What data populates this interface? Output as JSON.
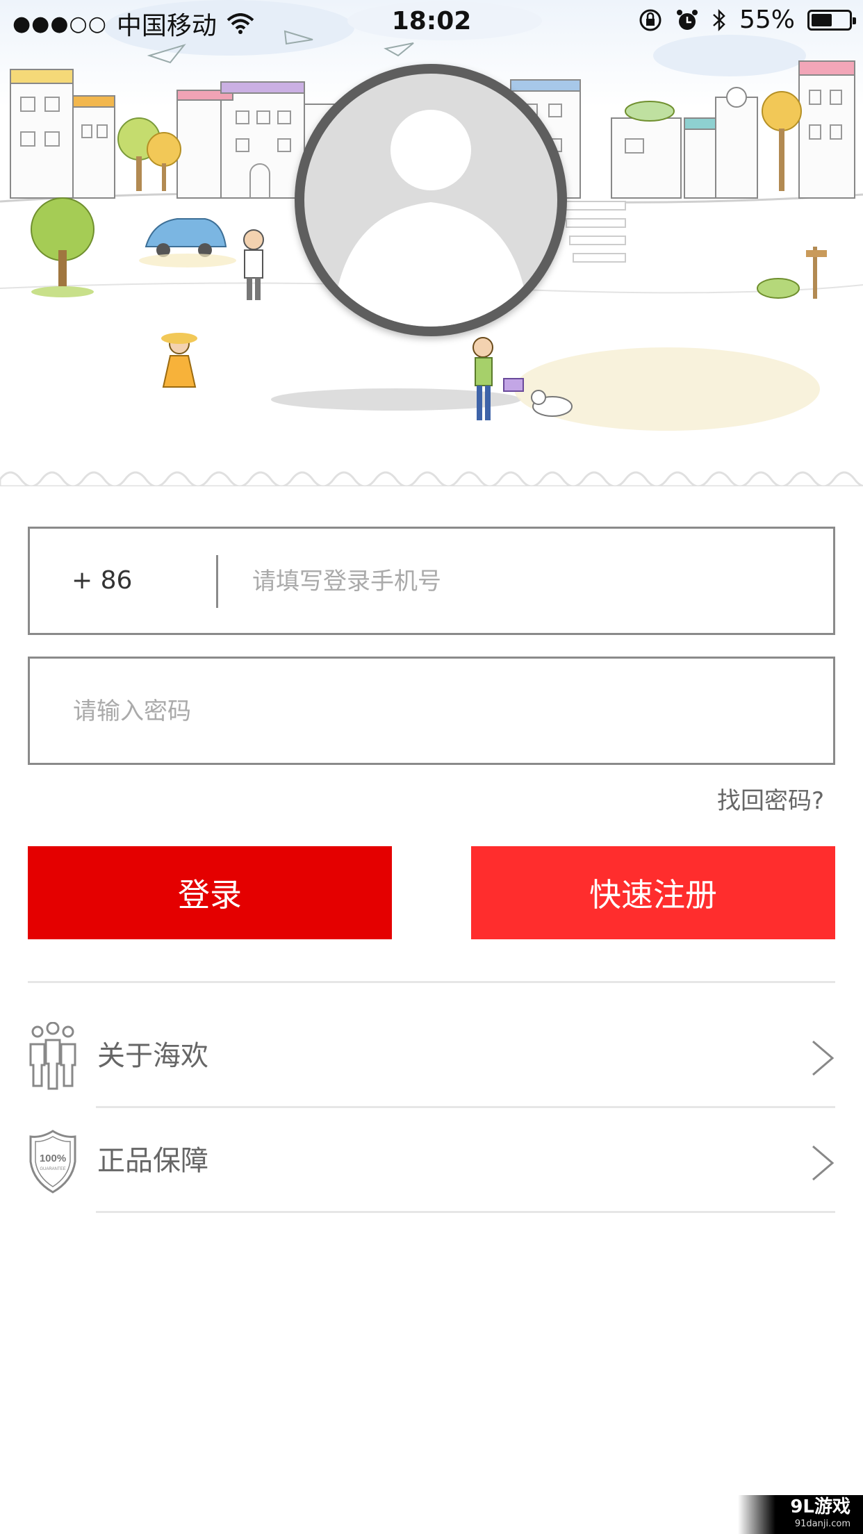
{
  "status_bar": {
    "signal": "●●●○○",
    "carrier": "中国移动",
    "time": "18:02",
    "battery_percent": "55%",
    "battery_level": 0.55
  },
  "login_form": {
    "country_code": "+ 86",
    "phone_placeholder": "请填写登录手机号",
    "password_placeholder": "请输入密码",
    "forgot_password": "找回密码?",
    "login_button": "登录",
    "register_button": "快速注册"
  },
  "menu": {
    "items": [
      {
        "label": "关于海欢",
        "icon": "people-icon"
      },
      {
        "label": "正品保障",
        "icon": "shield-100-icon"
      }
    ]
  },
  "watermark": {
    "brand": "9L游戏",
    "site": "91danji.com"
  },
  "colors": {
    "login": "#e40000",
    "register": "#ff2d2d",
    "border": "#8a8a8a"
  }
}
